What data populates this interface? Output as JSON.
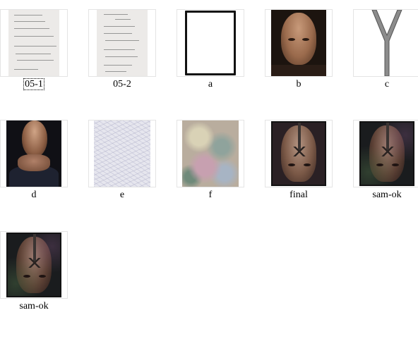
{
  "items": [
    {
      "label": "05-1",
      "kind": "notes",
      "selected": true
    },
    {
      "label": "05-2",
      "kind": "notes",
      "selected": false
    },
    {
      "label": "a",
      "kind": "frame-icon",
      "selected": false
    },
    {
      "label": "b",
      "kind": "portrait-icon",
      "selected": false
    },
    {
      "label": "c",
      "kind": "zipper-icon",
      "selected": false
    },
    {
      "label": "d",
      "kind": "portrait-hands-icon",
      "selected": false
    },
    {
      "label": "e",
      "kind": "texture-icon",
      "selected": false
    },
    {
      "label": "f",
      "kind": "texture-icon",
      "selected": false
    },
    {
      "label": "final",
      "kind": "composite-icon",
      "selected": false
    },
    {
      "label": "sam-ok",
      "kind": "composite-icon",
      "selected": false
    },
    {
      "label": "sam-ok",
      "kind": "composite-icon",
      "selected": false
    }
  ]
}
